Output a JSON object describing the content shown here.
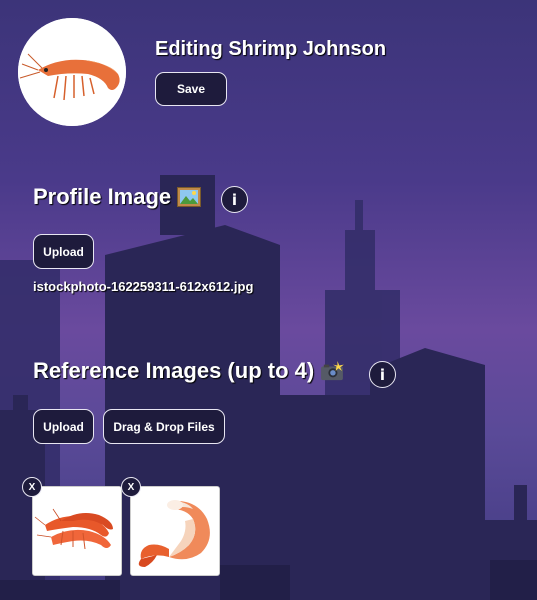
{
  "header": {
    "title": "Editing Shrimp Johnson",
    "save_label": "Save"
  },
  "profile_section": {
    "title": "Profile Image",
    "title_icon": "framed-picture-icon",
    "info_label": "i",
    "upload_label": "Upload",
    "filename": "istockphoto-162259311-612x612.jpg"
  },
  "reference_section": {
    "title": "Reference Images (up to 4)",
    "title_icon": "camera-flash-icon",
    "info_label": "i",
    "upload_label": "Upload",
    "dragdrop_label": "Drag & Drop Files",
    "images": [
      {
        "remove_label": "X",
        "icon": "shrimp-pile-image"
      },
      {
        "remove_label": "X",
        "icon": "shrimp-tail-image"
      }
    ]
  },
  "colors": {
    "button_bg": "#1e1b3c",
    "button_border": "#e8e6f2",
    "background_top": "#3c3479",
    "background_mid": "#6a4a9e",
    "skyline": "#2a2656"
  }
}
